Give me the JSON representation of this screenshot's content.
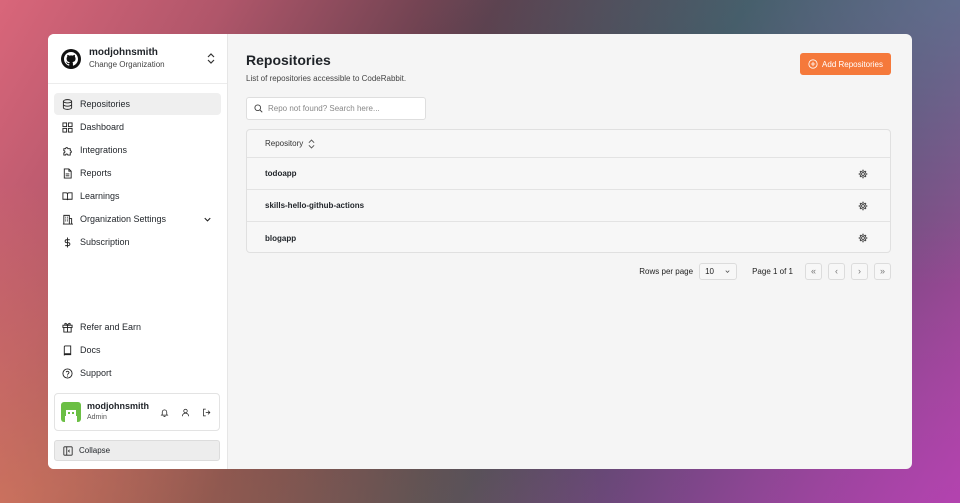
{
  "org": {
    "name": "modjohnsmith",
    "subtitle": "Change Organization"
  },
  "nav": {
    "items": [
      {
        "label": "Repositories",
        "icon": "database-icon",
        "active": true
      },
      {
        "label": "Dashboard",
        "icon": "grid-icon"
      },
      {
        "label": "Integrations",
        "icon": "puzzle-icon"
      },
      {
        "label": "Reports",
        "icon": "file-icon"
      },
      {
        "label": "Learnings",
        "icon": "book-open-icon"
      },
      {
        "label": "Organization Settings",
        "icon": "building-icon",
        "expandable": true
      },
      {
        "label": "Subscription",
        "icon": "dollar-icon"
      }
    ],
    "bottom": [
      {
        "label": "Refer and Earn",
        "icon": "gift-icon"
      },
      {
        "label": "Docs",
        "icon": "book-icon"
      },
      {
        "label": "Support",
        "icon": "help-icon"
      }
    ]
  },
  "user": {
    "name": "modjohnsmith",
    "role": "Admin"
  },
  "collapse_label": "Collapse",
  "main": {
    "title": "Repositories",
    "subtitle": "List of repositories accessible to CodeRabbit.",
    "add_button": "Add Repositories",
    "search_placeholder": "Repo not found? Search here...",
    "table": {
      "header": "Repository",
      "rows": [
        "todoapp",
        "skills-hello-github-actions",
        "blogapp"
      ]
    },
    "pager": {
      "rows_label": "Rows per page",
      "rows_value": "10",
      "page_info": "Page 1 of 1"
    }
  },
  "colors": {
    "accent": "#f5793b",
    "active_bg": "#efefef"
  }
}
